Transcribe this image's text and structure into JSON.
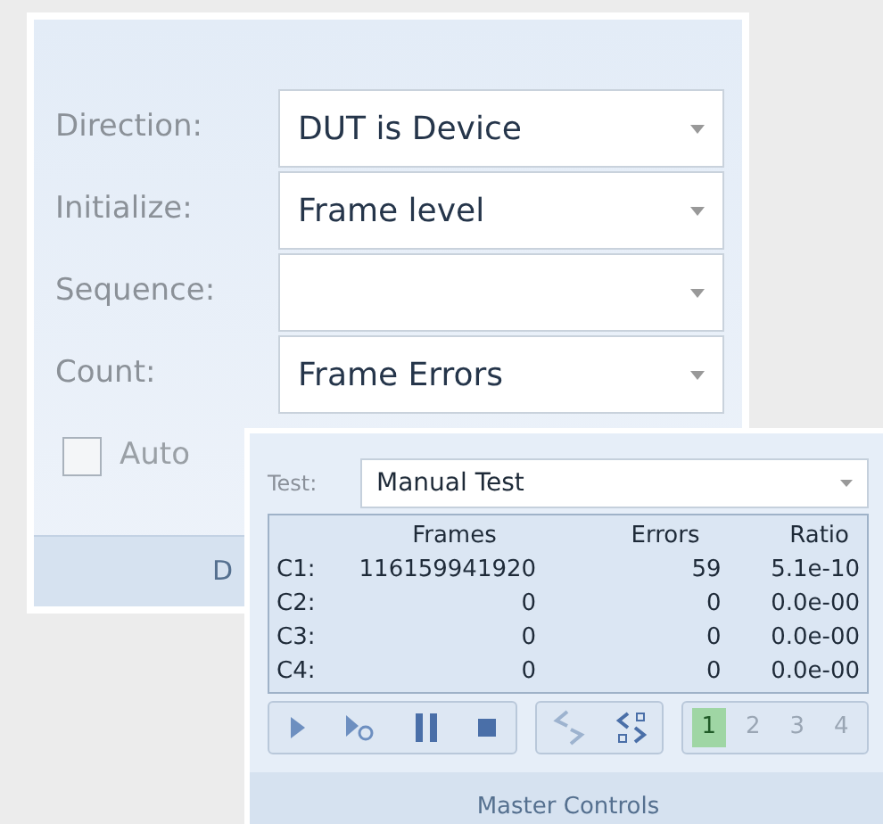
{
  "settings_panel": {
    "fields": [
      {
        "label": "Direction:",
        "value": "DUT is Device"
      },
      {
        "label": "Initialize:",
        "value": "Frame level"
      },
      {
        "label": "Sequence:"
      },
      {
        "label": "Count:",
        "value": "Frame Errors"
      }
    ],
    "auto_checkbox": {
      "label": "Auto",
      "checked": false
    },
    "footer": "D"
  },
  "master_controls": {
    "test_label": "Test:",
    "test_value": "Manual Test",
    "columns": [
      "Frames",
      "Errors",
      "Ratio"
    ],
    "rows": [
      {
        "channel": "C1:",
        "frames": "116159941920",
        "errors": "59",
        "ratio": "5.1e-10"
      },
      {
        "channel": "C2:",
        "frames": "0",
        "errors": "0",
        "ratio": "0.0e-00"
      },
      {
        "channel": "C3:",
        "frames": "0",
        "errors": "0",
        "ratio": "0.0e-00"
      },
      {
        "channel": "C4:",
        "frames": "0",
        "errors": "0",
        "ratio": "0.0e-00"
      }
    ],
    "channel_buttons": [
      {
        "label": "1",
        "selected": true
      },
      {
        "label": "2",
        "selected": false
      },
      {
        "label": "3",
        "selected": false
      },
      {
        "label": "4",
        "selected": false
      }
    ],
    "footer": "Master Controls"
  }
}
